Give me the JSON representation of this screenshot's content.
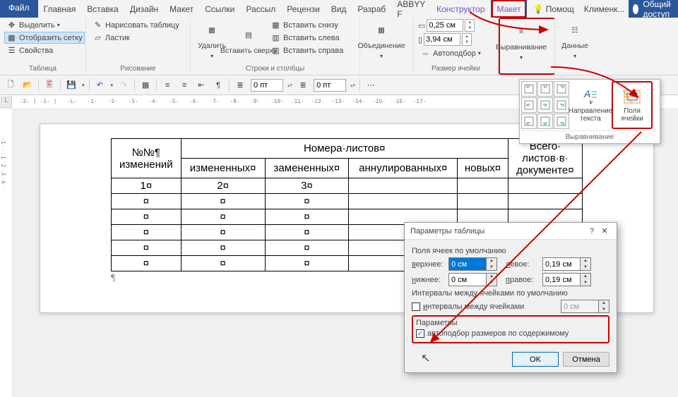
{
  "titlebar": {
    "file": "Файл",
    "tabs": [
      "Главная",
      "Вставка",
      "Дизайн",
      "Макет",
      "Ссылки",
      "Рассыл",
      "Рецензи",
      "Вид",
      "Разраб",
      "ABBYY F",
      "Конструктор",
      "Макет"
    ],
    "help_icon": "?",
    "help": "Помощ",
    "user": "Клименк...",
    "share": "Общий доступ"
  },
  "ribbon": {
    "table": {
      "select": "Выделить",
      "grid": "Отобразить сетку",
      "props": "Свойства",
      "label": "Таблица"
    },
    "draw": {
      "draw": "Нарисовать таблицу",
      "eraser": "Ластик",
      "label": "Рисование"
    },
    "rows": {
      "delete": "Удалить",
      "ins_top": "Вставить сверху",
      "ins_bottom": "Вставить снизу",
      "ins_left": "Вставить слева",
      "ins_right": "Вставить справа",
      "label": "Строки и столбцы"
    },
    "merge": {
      "merge": "Объединение",
      "label": ""
    },
    "size": {
      "h": "0,25 см",
      "w": "3,94 см",
      "autofit": "Автоподбор",
      "label": "Размер ячейки"
    },
    "align": {
      "align": "Выравнивание",
      "data": "Данные"
    }
  },
  "qat": {
    "pt1": "0 пт",
    "pt2": "0 пт"
  },
  "ruler_corner": "L",
  "doc_table": {
    "h1": "№№¶\nизменений",
    "h2": "Номера·листов¤",
    "h2a": "измененных¤",
    "h2b": "замененных¤",
    "h2c": "аннулированных¤",
    "h2d": "новых¤",
    "h3": "Всего·\nлистов·в·\nдокументе¤",
    "r1": [
      "1¤",
      "2¤",
      "3¤",
      "",
      "",
      ""
    ],
    "empty": "¤"
  },
  "align_callout": {
    "direction": "Направление текста",
    "margins": "Поля ячейки",
    "footer": "Выравнивание"
  },
  "dialog": {
    "title": "Параметры таблицы",
    "sec1": "Поля ячеек по умолчанию",
    "top": "верхнее:",
    "bottom": "нижнее:",
    "left": "левое:",
    "right": "правое:",
    "v_top": "0 см",
    "v_bottom": "0 см",
    "v_left": "0,19 см",
    "v_right": "0,19 см",
    "sec2": "Интервалы между ячейками по умолчанию",
    "chk_spacing": "интервалы между ячейками",
    "v_spacing": "0 см",
    "sec3": "Параметры",
    "chk_autofit": "автоподбор размеров по содержимому",
    "ok": "OK",
    "cancel": "Отмена"
  }
}
